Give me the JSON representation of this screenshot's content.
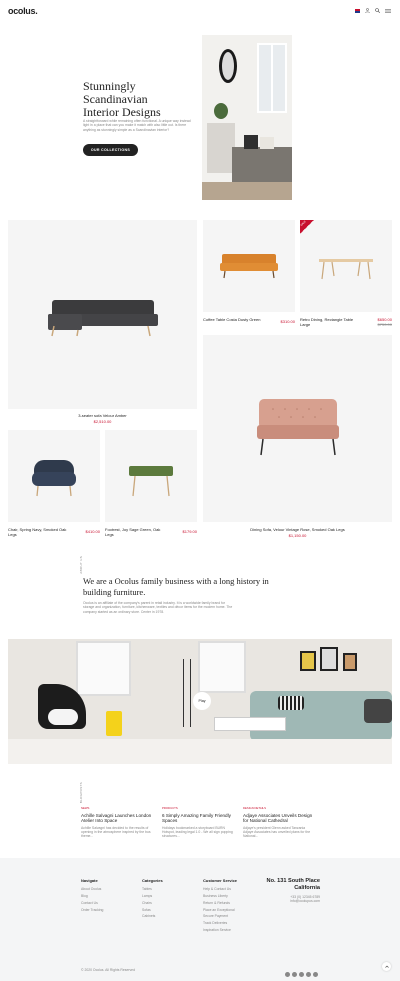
{
  "header": {
    "logo": "ocolus.",
    "icons": [
      "flag-icon",
      "user-icon",
      "search-icon",
      "menu-icon"
    ]
  },
  "hero": {
    "title_line1": "Stunningly",
    "title_line2": "Scandinavian",
    "title_line3": "Interior Designs",
    "text": "A straightforward while remaining often functional. A unique way instead light in a place that can you make it match with also little out. Is there anything as stunningly simple as a Scandinavian interior?",
    "button": "OUR COLLECTIONS"
  },
  "products": {
    "big": {
      "name": "3-seater sofa Velour Amber",
      "price": "$2,510.00"
    },
    "coffee": {
      "name": "Coffee Table Costa Dusty Green",
      "price": "$310.00"
    },
    "retro": {
      "name": "Retro Dining, Rectangle Table Large",
      "price": "$650.00",
      "old_price": "$750.00",
      "badge": "SALE"
    },
    "chair": {
      "name": "Chair, Spring Navy, Smoked Oak Legs",
      "price": "$410.00"
    },
    "footrest": {
      "name": "Footrest, Joy Sage Green, Oak Legs",
      "price": "$179.00"
    },
    "dining_sofa": {
      "name": "Dining Sofa, Velour Vintage Rose, Smoked Oak Legs",
      "price": "$1,150.00"
    }
  },
  "about": {
    "label": "ABOUT US",
    "title": "We are a Ocolus family business with a long history in building furniture.",
    "text": "Ocolus is an affiliate of the company's parent in retail industry. It is a worldwide family brand for storage and organization, furniture, kitchenware, textiles and décor items for the modern home. The company started as an ordinary store. Center in 1978."
  },
  "video": {
    "play": "Play"
  },
  "blog": {
    "label": "BLOGPOSTS",
    "posts": [
      {
        "cat": "NEWS",
        "title": "Achille Salvagni Launches London Atelier Into Space",
        "text": "Achille Salvagni has decided to the results of opening in the atmosphere inspired by the bus theme..."
      },
      {
        "cat": "PRODUCTS",
        "title": "6 Simply Amazing Family Friendly Spaces",
        "text": "Holidays bookmarked a storyboard BURN Hotspot, leading legal 1.0 - We all sign popping structures..."
      },
      {
        "cat": "DESIGN DETAILS",
        "title": "Adjaye Associates Unveils Design for National Cathedral",
        "text": "Adjaye's president Glenn asked Tanzania Adjaye Associates has unveiled plans for the National..."
      }
    ]
  },
  "footer": {
    "navigate": {
      "title": "Navigate",
      "items": [
        "About Ocolus",
        "Blog",
        "Contact Us",
        "Order Tracking"
      ]
    },
    "categories": {
      "title": "Categories",
      "items": [
        "Tables",
        "Lamps",
        "Chairs",
        "Sofas",
        "Cabinets"
      ]
    },
    "service": {
      "title": "Customer Service",
      "items": [
        "Help & Contact Us",
        "Business Liberty",
        "Return & Refunds",
        "Place an Exceptional",
        "Secure Payment",
        "Track Deliveries",
        "Inspiration Service"
      ]
    },
    "address_line1": "No. 131 South Place",
    "address_line2": "California",
    "phone": "+33 (0) 12345 6789",
    "email": "info@ocolupus.com",
    "copyright": "© 2020 Ocolus. All Rights Reserved",
    "socials": [
      "facebook-icon",
      "twitter-icon",
      "vimeo-icon",
      "pinterest-icon",
      "instagram-icon"
    ]
  },
  "colors": {
    "accent": "#c8102e",
    "dark": "#222222",
    "card": "#f5f5f5",
    "footer": "#f4f5f6"
  }
}
